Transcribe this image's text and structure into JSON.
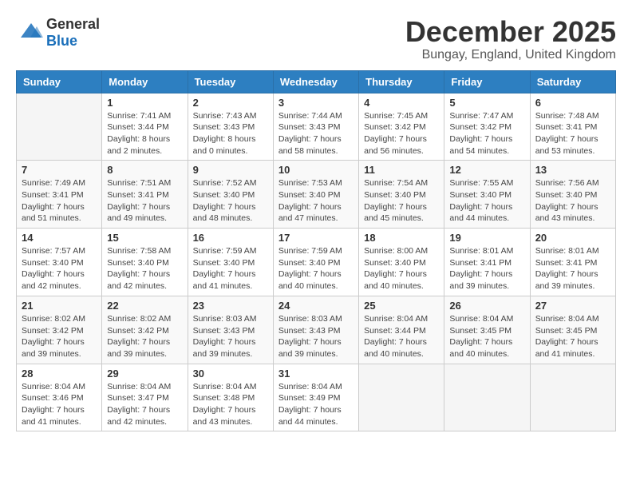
{
  "logo": {
    "general": "General",
    "blue": "Blue"
  },
  "title": "December 2025",
  "subtitle": "Bungay, England, United Kingdom",
  "days_header": [
    "Sunday",
    "Monday",
    "Tuesday",
    "Wednesday",
    "Thursday",
    "Friday",
    "Saturday"
  ],
  "weeks": [
    [
      {
        "day": "",
        "info": ""
      },
      {
        "day": "1",
        "info": "Sunrise: 7:41 AM\nSunset: 3:44 PM\nDaylight: 8 hours\nand 2 minutes."
      },
      {
        "day": "2",
        "info": "Sunrise: 7:43 AM\nSunset: 3:43 PM\nDaylight: 8 hours\nand 0 minutes."
      },
      {
        "day": "3",
        "info": "Sunrise: 7:44 AM\nSunset: 3:43 PM\nDaylight: 7 hours\nand 58 minutes."
      },
      {
        "day": "4",
        "info": "Sunrise: 7:45 AM\nSunset: 3:42 PM\nDaylight: 7 hours\nand 56 minutes."
      },
      {
        "day": "5",
        "info": "Sunrise: 7:47 AM\nSunset: 3:42 PM\nDaylight: 7 hours\nand 54 minutes."
      },
      {
        "day": "6",
        "info": "Sunrise: 7:48 AM\nSunset: 3:41 PM\nDaylight: 7 hours\nand 53 minutes."
      }
    ],
    [
      {
        "day": "7",
        "info": "Sunrise: 7:49 AM\nSunset: 3:41 PM\nDaylight: 7 hours\nand 51 minutes."
      },
      {
        "day": "8",
        "info": "Sunrise: 7:51 AM\nSunset: 3:41 PM\nDaylight: 7 hours\nand 49 minutes."
      },
      {
        "day": "9",
        "info": "Sunrise: 7:52 AM\nSunset: 3:40 PM\nDaylight: 7 hours\nand 48 minutes."
      },
      {
        "day": "10",
        "info": "Sunrise: 7:53 AM\nSunset: 3:40 PM\nDaylight: 7 hours\nand 47 minutes."
      },
      {
        "day": "11",
        "info": "Sunrise: 7:54 AM\nSunset: 3:40 PM\nDaylight: 7 hours\nand 45 minutes."
      },
      {
        "day": "12",
        "info": "Sunrise: 7:55 AM\nSunset: 3:40 PM\nDaylight: 7 hours\nand 44 minutes."
      },
      {
        "day": "13",
        "info": "Sunrise: 7:56 AM\nSunset: 3:40 PM\nDaylight: 7 hours\nand 43 minutes."
      }
    ],
    [
      {
        "day": "14",
        "info": "Sunrise: 7:57 AM\nSunset: 3:40 PM\nDaylight: 7 hours\nand 42 minutes."
      },
      {
        "day": "15",
        "info": "Sunrise: 7:58 AM\nSunset: 3:40 PM\nDaylight: 7 hours\nand 42 minutes."
      },
      {
        "day": "16",
        "info": "Sunrise: 7:59 AM\nSunset: 3:40 PM\nDaylight: 7 hours\nand 41 minutes."
      },
      {
        "day": "17",
        "info": "Sunrise: 7:59 AM\nSunset: 3:40 PM\nDaylight: 7 hours\nand 40 minutes."
      },
      {
        "day": "18",
        "info": "Sunrise: 8:00 AM\nSunset: 3:40 PM\nDaylight: 7 hours\nand 40 minutes."
      },
      {
        "day": "19",
        "info": "Sunrise: 8:01 AM\nSunset: 3:41 PM\nDaylight: 7 hours\nand 39 minutes."
      },
      {
        "day": "20",
        "info": "Sunrise: 8:01 AM\nSunset: 3:41 PM\nDaylight: 7 hours\nand 39 minutes."
      }
    ],
    [
      {
        "day": "21",
        "info": "Sunrise: 8:02 AM\nSunset: 3:42 PM\nDaylight: 7 hours\nand 39 minutes."
      },
      {
        "day": "22",
        "info": "Sunrise: 8:02 AM\nSunset: 3:42 PM\nDaylight: 7 hours\nand 39 minutes."
      },
      {
        "day": "23",
        "info": "Sunrise: 8:03 AM\nSunset: 3:43 PM\nDaylight: 7 hours\nand 39 minutes."
      },
      {
        "day": "24",
        "info": "Sunrise: 8:03 AM\nSunset: 3:43 PM\nDaylight: 7 hours\nand 39 minutes."
      },
      {
        "day": "25",
        "info": "Sunrise: 8:04 AM\nSunset: 3:44 PM\nDaylight: 7 hours\nand 40 minutes."
      },
      {
        "day": "26",
        "info": "Sunrise: 8:04 AM\nSunset: 3:45 PM\nDaylight: 7 hours\nand 40 minutes."
      },
      {
        "day": "27",
        "info": "Sunrise: 8:04 AM\nSunset: 3:45 PM\nDaylight: 7 hours\nand 41 minutes."
      }
    ],
    [
      {
        "day": "28",
        "info": "Sunrise: 8:04 AM\nSunset: 3:46 PM\nDaylight: 7 hours\nand 41 minutes."
      },
      {
        "day": "29",
        "info": "Sunrise: 8:04 AM\nSunset: 3:47 PM\nDaylight: 7 hours\nand 42 minutes."
      },
      {
        "day": "30",
        "info": "Sunrise: 8:04 AM\nSunset: 3:48 PM\nDaylight: 7 hours\nand 43 minutes."
      },
      {
        "day": "31",
        "info": "Sunrise: 8:04 AM\nSunset: 3:49 PM\nDaylight: 7 hours\nand 44 minutes."
      },
      {
        "day": "",
        "info": ""
      },
      {
        "day": "",
        "info": ""
      },
      {
        "day": "",
        "info": ""
      }
    ]
  ]
}
